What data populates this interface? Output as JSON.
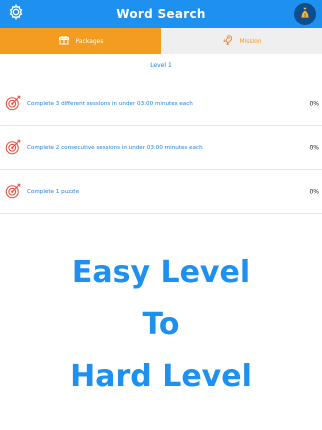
{
  "header": {
    "title": "Word Search",
    "settings_icon": "gear-icon",
    "coin_icon": "money-bag-icon",
    "brand_color": "#1e90f0"
  },
  "tabs": [
    {
      "label": "Packages",
      "icon": "gift-icon",
      "active": true
    },
    {
      "label": "Mission",
      "icon": "rocket-icon",
      "active": false
    }
  ],
  "level": {
    "label": "Level 1"
  },
  "missions": [
    {
      "text": "Complete 3 different sessions in under 03:00 minutes each",
      "progress": "0%",
      "icon": "target-icon"
    },
    {
      "text": "Complete 2 consecutive sessions in under 03:00 minutes each",
      "progress": "0%",
      "icon": "target-icon"
    },
    {
      "text": "Complete 1 puzzle",
      "progress": "0%",
      "icon": "target-icon"
    }
  ],
  "promo": {
    "line1": "Easy Level",
    "line2": "To",
    "line3": "Hard Level"
  },
  "colors": {
    "accent_orange": "#f39c1f",
    "text_blue": "#1e7fe0",
    "target_red": "#e84a3a"
  }
}
